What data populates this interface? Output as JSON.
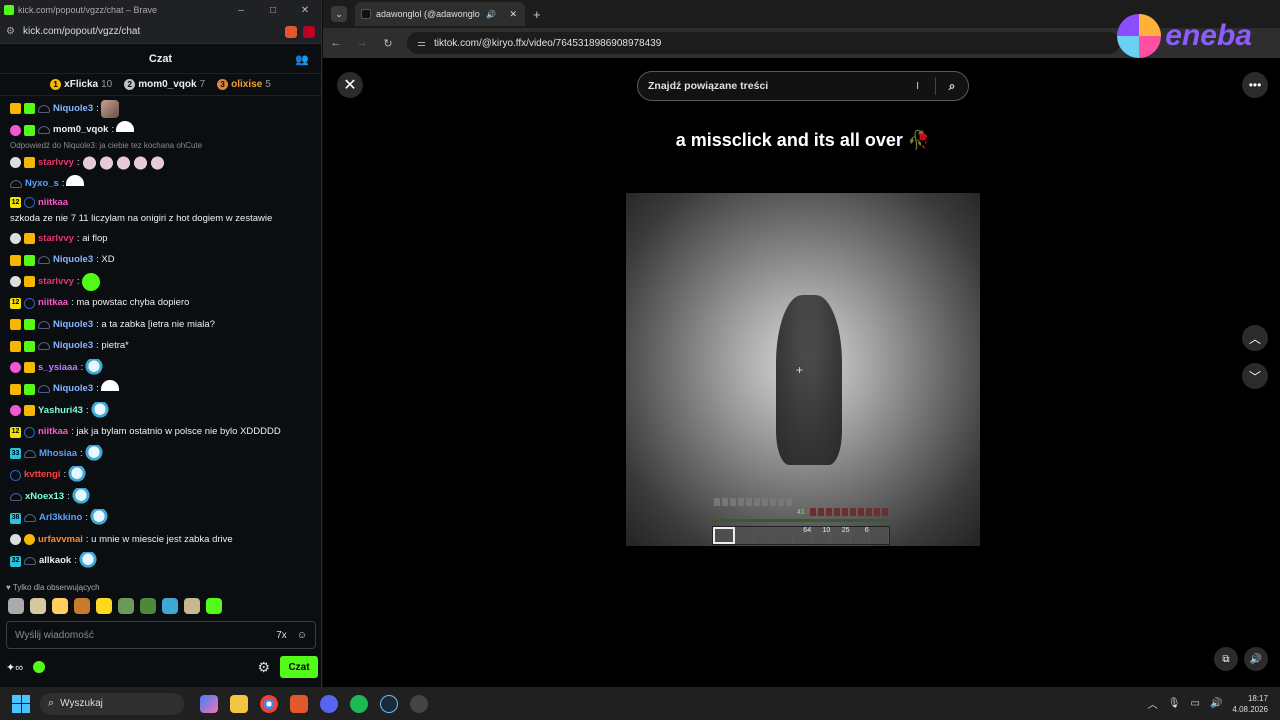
{
  "chat_window": {
    "title": "kick.com/popout/vgzz/chat – Brave",
    "url": "kick.com/popout/vgzz/chat",
    "header": "Czat",
    "leaderboard": [
      {
        "rank": "1",
        "name": "xFlicka",
        "points": "10",
        "color": "#f5b700"
      },
      {
        "rank": "2",
        "name": "mom0_vqok",
        "points": "7",
        "color": "#c0c0c0"
      },
      {
        "rank": "3",
        "name": "olixise",
        "points": "5",
        "color": "#d8893a"
      }
    ],
    "reply_note": "Odpowiedź do Niquole3: ja ciebie tez kochana ohCute",
    "messages": [
      {
        "user": "Niquole3",
        "text": ""
      },
      {
        "user": "mom0_vqok",
        "text": ""
      },
      {
        "user": "starlvvy",
        "text": ""
      },
      {
        "user": "Nyxo_s",
        "text": ""
      },
      {
        "user": "niitkaa",
        "text": "szkoda ze nie 7 11 liczylam na onigiri z hot dogiem w zestawie"
      },
      {
        "user": "starlvvy",
        "text": "ai flop"
      },
      {
        "user": "Niquole3",
        "text": "XD"
      },
      {
        "user": "starlvvy",
        "text": ""
      },
      {
        "user": "niitkaa",
        "text": "ma powstac chyba dopiero"
      },
      {
        "user": "Niquole3",
        "text": "a ta zabka [ietra nie miala?"
      },
      {
        "user": "Niquole3",
        "text": "pietra*"
      },
      {
        "user": "s_ysiaaa",
        "text": ""
      },
      {
        "user": "Niquole3",
        "text": ""
      },
      {
        "user": "Yashuri43",
        "text": ""
      },
      {
        "user": "niitkaa",
        "text": "jak ja bylam ostatnio w polsce nie bylo XDDDDD"
      },
      {
        "user": "Mhosiaa",
        "text": ""
      },
      {
        "user": "kvttengi",
        "text": ""
      },
      {
        "user": "xNoex13",
        "text": ""
      },
      {
        "user": "Arl3kkino",
        "text": ""
      },
      {
        "user": "urfavvmai",
        "text": "u mnie w miescie jest zabka drive"
      },
      {
        "user": "allkaok",
        "text": ""
      }
    ],
    "followers_only": "Tylko dla obserwujących",
    "input_placeholder": "Wyślij wiadomość",
    "send_label": "Czat"
  },
  "browser": {
    "tab_title": "adawonglol (@adawonglol)",
    "url": "tiktok.com/@kiryo.ffx/video/7645318986908978439",
    "search_placeholder": "Znajdź powiązane treści",
    "caption": "a missclick and its all over 🥀",
    "hud_level": "41",
    "hotbar_counts": [
      "64",
      "10",
      "25",
      "6"
    ]
  },
  "overlay": {
    "brand": "eneba"
  },
  "taskbar": {
    "search_label": "Wyszukaj",
    "time": "18:17",
    "date": "4.08.2026"
  }
}
